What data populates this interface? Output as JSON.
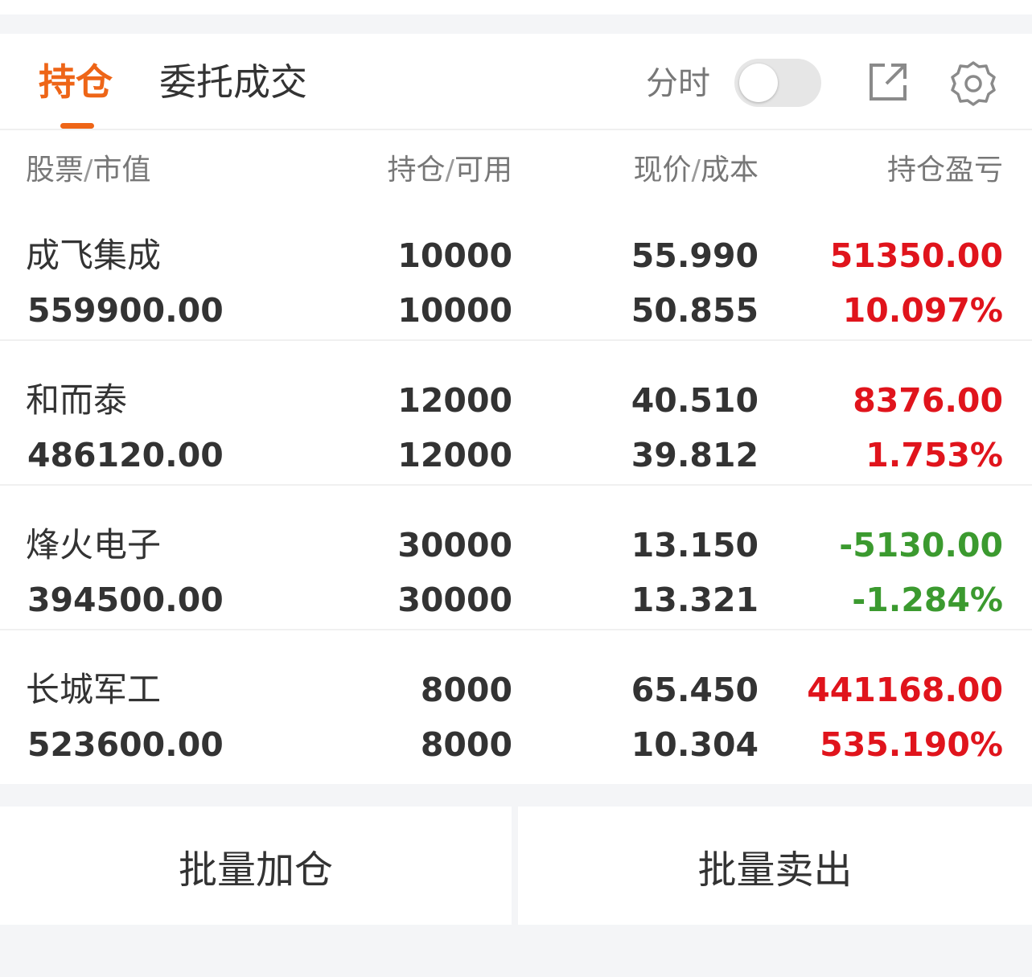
{
  "tabs": {
    "holdings": "持仓",
    "orders": "委托成交"
  },
  "header": {
    "timeshare_label": "分时",
    "timeshare_on": false
  },
  "columns": {
    "stock": "股票",
    "market_value": "市值",
    "position": "持仓",
    "available": "可用",
    "price": "现价",
    "cost": "成本",
    "profit_loss": "持仓盈亏",
    "slash": "/"
  },
  "rows": [
    {
      "name": "成飞集成",
      "market_value": "559900.00",
      "position": "10000",
      "available": "10000",
      "price": "55.990",
      "cost": "50.855",
      "profit": "51350.00",
      "profit_pct": "10.097%",
      "trend": "up"
    },
    {
      "name": "和而泰",
      "market_value": "486120.00",
      "position": "12000",
      "available": "12000",
      "price": "40.510",
      "cost": "39.812",
      "profit": "8376.00",
      "profit_pct": "1.753%",
      "trend": "up"
    },
    {
      "name": "烽火电子",
      "market_value": "394500.00",
      "position": "30000",
      "available": "30000",
      "price": "13.150",
      "cost": "13.321",
      "profit": "-5130.00",
      "profit_pct": "-1.284%",
      "trend": "down"
    },
    {
      "name": "长城军工",
      "market_value": "523600.00",
      "position": "8000",
      "available": "8000",
      "price": "65.450",
      "cost": "10.304",
      "profit": "441168.00",
      "profit_pct": "535.190%",
      "trend": "up"
    }
  ],
  "actions": {
    "batch_add": "批量加仓",
    "batch_sell": "批量卖出"
  },
  "colors": {
    "accent": "#ee6517",
    "up": "#e0141c",
    "down": "#3b9a2f"
  },
  "icons": {
    "share": "share-external-icon",
    "settings": "gear-icon"
  }
}
